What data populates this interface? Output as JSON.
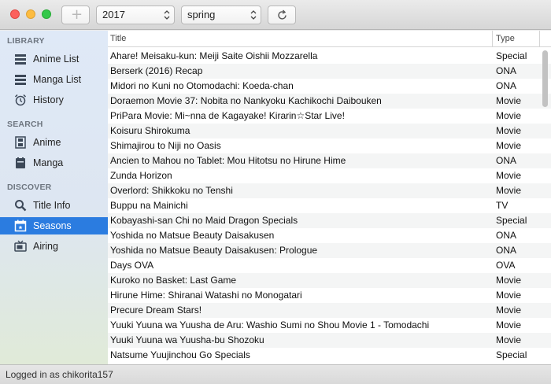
{
  "toolbar": {
    "add_icon": "plus-icon",
    "year_value": "2017",
    "season_value": "spring",
    "refresh_icon": "refresh-icon"
  },
  "sidebar": {
    "sections": [
      {
        "label": "LIBRARY"
      },
      {
        "label": "SEARCH"
      },
      {
        "label": "DISCOVER"
      }
    ],
    "items": [
      {
        "label": "Anime List",
        "icon": "list-icon"
      },
      {
        "label": "Manga List",
        "icon": "list-icon"
      },
      {
        "label": "History",
        "icon": "alarm-clock-icon"
      },
      {
        "label": "Anime",
        "icon": "film-icon"
      },
      {
        "label": "Manga",
        "icon": "book-icon"
      },
      {
        "label": "Title Info",
        "icon": "magnifier-icon"
      },
      {
        "label": "Seasons",
        "icon": "calendar-icon"
      },
      {
        "label": "Airing",
        "icon": "tv-icon"
      }
    ],
    "active_item": "Seasons"
  },
  "table": {
    "columns": [
      "Title",
      "Type"
    ],
    "rows": [
      {
        "title": "Ahare! Meisaku-kun: Meiji Saite Oishii Mozzarella",
        "type": "Special"
      },
      {
        "title": "Berserk (2016) Recap",
        "type": "ONA"
      },
      {
        "title": "Midori no Kuni no Otomodachi: Koeda-chan",
        "type": "ONA"
      },
      {
        "title": "Doraemon Movie 37: Nobita no Nankyoku Kachikochi Daibouken",
        "type": "Movie"
      },
      {
        "title": "PriPara Movie: Mi~nna de Kagayake! Kirarin☆Star Live!",
        "type": "Movie"
      },
      {
        "title": "Koisuru Shirokuma",
        "type": "Movie"
      },
      {
        "title": "Shimajirou to Niji no Oasis",
        "type": "Movie"
      },
      {
        "title": "Ancien to Mahou no Tablet: Mou Hitotsu no Hirune Hime",
        "type": "ONA"
      },
      {
        "title": "Zunda Horizon",
        "type": "Movie"
      },
      {
        "title": "Overlord: Shikkoku no Tenshi",
        "type": "Movie"
      },
      {
        "title": "Buppu na Mainichi",
        "type": "TV"
      },
      {
        "title": "Kobayashi-san Chi no Maid Dragon Specials",
        "type": "Special"
      },
      {
        "title": "Yoshida no Matsue Beauty Daisakusen",
        "type": "ONA"
      },
      {
        "title": "Yoshida no Matsue Beauty Daisakusen: Prologue",
        "type": "ONA"
      },
      {
        "title": "Days OVA",
        "type": "OVA"
      },
      {
        "title": "Kuroko no Basket: Last Game",
        "type": "Movie"
      },
      {
        "title": "Hirune Hime: Shiranai Watashi no Monogatari",
        "type": "Movie"
      },
      {
        "title": "Precure Dream Stars!",
        "type": "Movie"
      },
      {
        "title": "Yuuki Yuuna wa Yuusha de Aru: Washio Sumi no Shou Movie 1 - Tomodachi",
        "type": "Movie"
      },
      {
        "title": "Yuuki Yuuna wa Yuusha-bu Shozoku",
        "type": "Movie"
      },
      {
        "title": "Natsume Yuujinchou Go Specials",
        "type": "Special"
      }
    ]
  },
  "status": {
    "text": "Logged in as chikorita157"
  },
  "colors": {
    "accent": "#2b7ce0",
    "close": "#fc605c",
    "minimize": "#fdbc40",
    "maximize": "#34c84a"
  }
}
